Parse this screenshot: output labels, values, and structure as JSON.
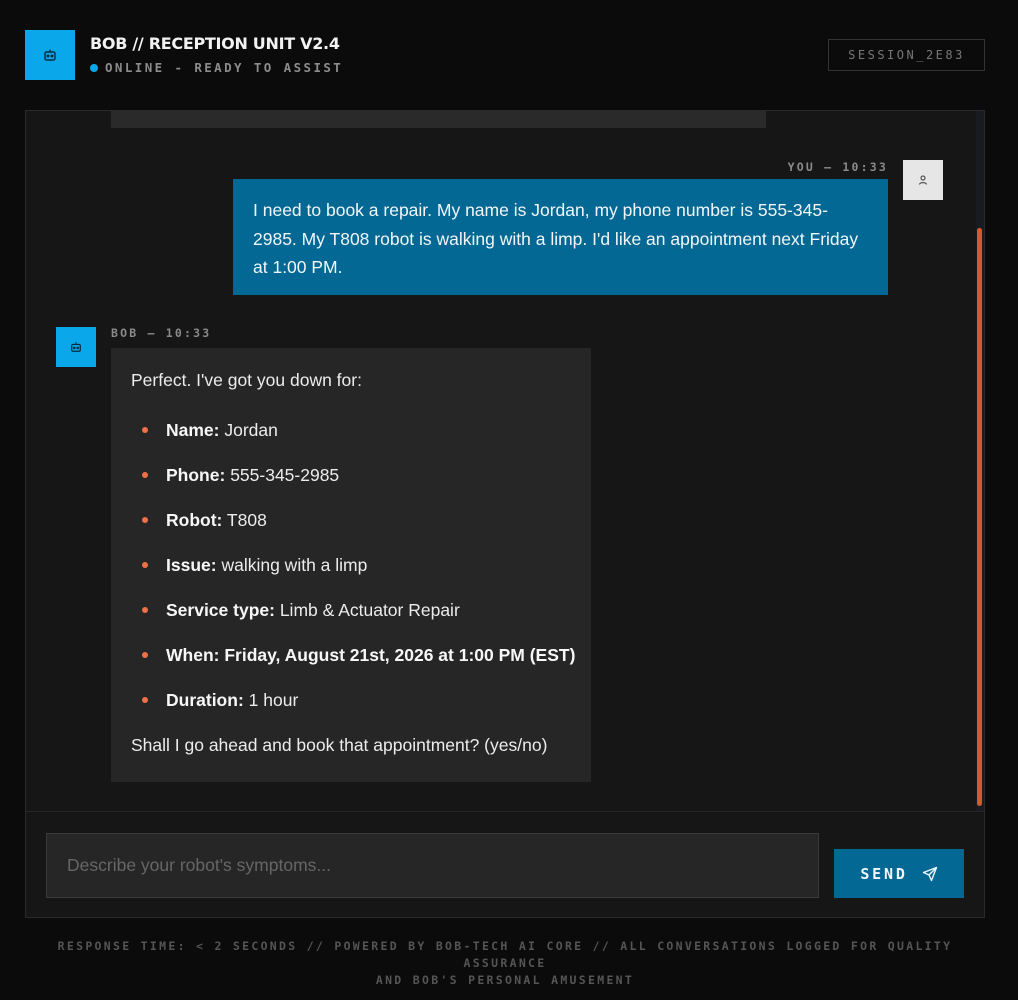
{
  "header": {
    "title": "BOB // RECEPTION UNIT V2.4",
    "status": "ONLINE - READY TO ASSIST",
    "session": "SESSION_2E83"
  },
  "user_message": {
    "meta": "YOU — 10:33",
    "text": "I need to book a repair. My name is Jordan, my phone number is 555-345-2985. My T808 robot is walking with a limp. I'd like an appointment next Friday at 1:00 PM."
  },
  "bot_message": {
    "meta": "BOB — 10:33",
    "intro": "Perfect. I've got you down for:",
    "details": [
      {
        "key": "Name:",
        "value": "Jordan"
      },
      {
        "key": "Phone:",
        "value": "555-345-2985"
      },
      {
        "key": "Robot:",
        "value": "T808"
      },
      {
        "key": "Issue:",
        "value": "walking with a limp"
      },
      {
        "key": "Service type:",
        "value": "Limb & Actuator Repair"
      },
      {
        "key": "When:",
        "value": "Friday, August 21st, 2026 at 1:00 PM (EST)"
      },
      {
        "key": "Duration:",
        "value": "1 hour"
      }
    ],
    "closing": "Shall I go ahead and book that appointment? (yes/no)"
  },
  "composer": {
    "placeholder": "Describe your robot's symptoms...",
    "send_label": "SEND"
  },
  "footer": {
    "line1": "RESPONSE TIME: < 2 SECONDS // POWERED BY BOB-TECH AI CORE // ALL CONVERSATIONS LOGGED FOR QUALITY ASSURANCE",
    "line2": "AND BOB'S PERSONAL AMUSEMENT"
  },
  "icons": {
    "logo": "robot-icon",
    "user_avatar": "user-icon",
    "bot_avatar": "robot-icon",
    "send": "paper-plane-icon"
  },
  "colors": {
    "accent": "#0aa8ea",
    "user_bubble": "#046894",
    "bullet": "#f07047",
    "scroll_thumb": "#d65a2e"
  }
}
